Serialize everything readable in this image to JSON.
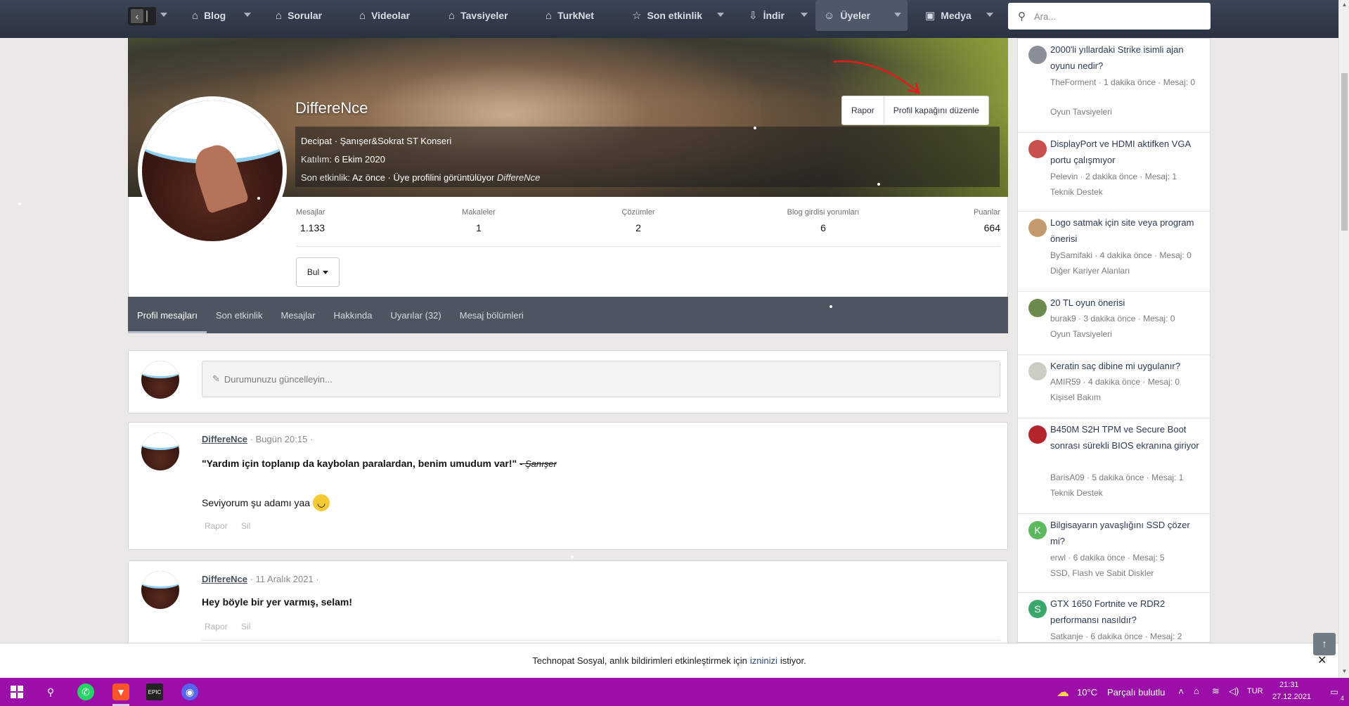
{
  "nav": {
    "items": [
      {
        "label": "Blog",
        "icon": "tag-icon"
      },
      {
        "label": "Sorular",
        "icon": "tag-icon"
      },
      {
        "label": "Videolar",
        "icon": "tag-icon"
      },
      {
        "label": "Tavsiyeler",
        "icon": "tag-icon"
      },
      {
        "label": "TurkNet",
        "icon": "tag-icon"
      },
      {
        "label": "Son etkinlik",
        "icon": "star-icon"
      },
      {
        "label": "İndir",
        "icon": "download-icon"
      },
      {
        "label": "Üyeler",
        "icon": "user-icon"
      },
      {
        "label": "Medya",
        "icon": "image-icon"
      }
    ],
    "search_placeholder": "Ara..."
  },
  "profile": {
    "name": "DiffereNce",
    "title_line": "Decipat · Şanışer&Sokrat ST Konseri",
    "joined_label": "Katılım:",
    "joined_value": "6 Ekim 2020",
    "last_activity_label": "Son etkinlik:",
    "last_activity_value": "Az önce · Üye profilini görüntülüyor",
    "last_activity_user": "DiffereNce",
    "buttons": {
      "report": "Rapor",
      "edit_cover": "Profil kapağını düzenle"
    },
    "stats": [
      {
        "key": "Mesajlar",
        "value": "1.133"
      },
      {
        "key": "Makaleler",
        "value": "1"
      },
      {
        "key": "Çözümler",
        "value": "2"
      },
      {
        "key": "Blog girdisi yorumları",
        "value": "6"
      },
      {
        "key": "Puanlar",
        "value": "664"
      }
    ],
    "find_button": "Bul"
  },
  "tabs": [
    "Profil mesajları",
    "Son etkinlik",
    "Mesajlar",
    "Hakkında",
    "Uyarılar (32)",
    "Mesaj bölümleri"
  ],
  "status_placeholder": "Durumunuzu güncelleyin...",
  "posts": [
    {
      "author": "DiffereNce",
      "date": "· Bugün 20:15 ·",
      "quote": "\"Yardım için toplanıp da kaybolan paralardan, benim umudum var!\"",
      "quote_source": "- Şanışer",
      "text": "Seviyorum şu adamı yaa",
      "emoji": "😀",
      "actions": [
        "Rapor",
        "Sil"
      ]
    },
    {
      "author": "DiffereNce",
      "date": "· 11 Aralık 2021 ·",
      "text": "Hey böyle bir yer varmış, selam!",
      "actions": [
        "Rapor",
        "Sil"
      ]
    }
  ],
  "sidebar": [
    {
      "title": "2000'li yıllardaki Strike isimli ajan oyunu nedir?",
      "meta": "TheForment · 1 dakika önce · Mesaj: 0",
      "forum": "Oyun Tavsiyeleri",
      "avatar_color": "#8a8e99"
    },
    {
      "title": "DisplayPort ve HDMI aktifken VGA portu çalışmıyor",
      "meta": "Pelevin · 2 dakika önce · Mesaj: 1",
      "forum": "Teknik Destek",
      "avatar_color": "#c7504a"
    },
    {
      "title": "Logo satmak için site veya program önerisi",
      "meta": "BySamifaki · 4 dakika önce · Mesaj: 0",
      "forum": "Diğer Kariyer Alanları",
      "avatar_color": "#c29a6e"
    },
    {
      "title": "20 TL oyun önerisi",
      "meta": "burak9 · 3 dakika önce · Mesaj: 0",
      "forum": "Oyun Tavsiyeleri",
      "avatar_color": "#6d8a4e"
    },
    {
      "title": "Keratin saç dibine mi uygulanır?",
      "meta": "AMIR59 · 4 dakika önce · Mesaj: 0",
      "forum": "Kişisel Bakım",
      "avatar_color": "#c9cfc5"
    },
    {
      "title": "B450M S2H TPM ve Secure Boot sonrası sürekli BIOS ekranına giriyor",
      "meta": "BarisA09 · 5 dakika önce · Mesaj: 1",
      "forum": "Teknik Destek",
      "avatar_color": "#b3242b"
    },
    {
      "title": "Bilgisayarın yavaşlığını SSD çözer mi?",
      "meta": "erwl · 6 dakika önce · Mesaj: 5",
      "forum": "SSD, Flash ve Sabit Diskler",
      "avatar_color": "#5cb85c",
      "letter": "K"
    },
    {
      "title": "GTX 1650 Fortnite ve RDR2 performansı nasıldır?",
      "meta": "Satkanje · 6 dakika önce · Mesaj: 2",
      "forum": "",
      "avatar_color": "#3aa86b",
      "letter": "S"
    }
  ],
  "notification": {
    "text": "Technopat Sosyal, anlık bildirimleri etkinleştirmek için",
    "link": "izninizi",
    "suffix": "istiyor."
  },
  "taskbar": {
    "weather_temp": "10°C",
    "weather_desc": "Parçalı bulutlu",
    "lang": "TUR",
    "time": "21:31",
    "date": "27.12.2021",
    "notif_count": "4"
  }
}
